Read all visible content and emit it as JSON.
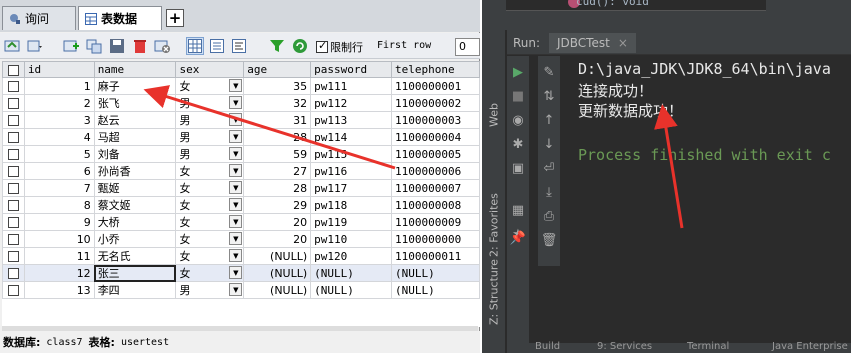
{
  "tabs": {
    "query": "询问",
    "table_data": "表数据",
    "add": "+"
  },
  "toolbar": {
    "limit_rows_label": "限制行",
    "first_row_label": "First row",
    "first_row_value": "0"
  },
  "grid": {
    "columns": [
      "id",
      "name",
      "sex",
      "age",
      "password",
      "telephone"
    ],
    "rows": [
      {
        "id": "1",
        "name": "麻子",
        "sex": "女",
        "age": "35",
        "password": "pw111",
        "telephone": "1100000001"
      },
      {
        "id": "2",
        "name": "张飞",
        "sex": "男",
        "age": "32",
        "password": "pw112",
        "telephone": "1100000002"
      },
      {
        "id": "3",
        "name": "赵云",
        "sex": "男",
        "age": "31",
        "password": "pw113",
        "telephone": "1100000003"
      },
      {
        "id": "4",
        "name": "马超",
        "sex": "男",
        "age": "28",
        "password": "pw114",
        "telephone": "1100000004"
      },
      {
        "id": "5",
        "name": "刘备",
        "sex": "男",
        "age": "59",
        "password": "pw115",
        "telephone": "1100000005"
      },
      {
        "id": "6",
        "name": "孙尚香",
        "sex": "女",
        "age": "27",
        "password": "pw116",
        "telephone": "1100000006"
      },
      {
        "id": "7",
        "name": "甄姬",
        "sex": "女",
        "age": "28",
        "password": "pw117",
        "telephone": "1100000007"
      },
      {
        "id": "8",
        "name": "蔡文姬",
        "sex": "女",
        "age": "29",
        "password": "pw118",
        "telephone": "1100000008"
      },
      {
        "id": "9",
        "name": "大桥",
        "sex": "女",
        "age": "20",
        "password": "pw119",
        "telephone": "1100000009"
      },
      {
        "id": "10",
        "name": "小乔",
        "sex": "女",
        "age": "20",
        "password": "pw110",
        "telephone": "1100000000"
      },
      {
        "id": "11",
        "name": "无名氏",
        "sex": "女",
        "age": "(NULL)",
        "password": "pw120",
        "telephone": "1100000011"
      },
      {
        "id": "12",
        "name": "张三",
        "sex": "女",
        "age": "(NULL)",
        "password": "(NULL)",
        "telephone": "(NULL)"
      },
      {
        "id": "13",
        "name": "李四",
        "sex": "男",
        "age": "(NULL)",
        "password": "(NULL)",
        "telephone": "(NULL)"
      }
    ]
  },
  "status": {
    "db_label": "数据库:",
    "db_value": "class7",
    "table_label": "表格:",
    "table_value": "usertest"
  },
  "ide": {
    "editor_peek": "cud(): void",
    "run_label": "Run:",
    "run_tab": "JDBCTest",
    "side_tabs": [
      "Web",
      "2: Favorites",
      "Z: Structure"
    ],
    "console_lines": [
      {
        "text": "D:\\java_JDK\\JDK8_64\\bin\\java",
        "color": "#e8e8e8"
      },
      {
        "text": "连接成功！",
        "color": "#e8e8e8"
      },
      {
        "text": "更新数据成功！",
        "color": "#e8e8e8"
      },
      {
        "text": "Process finished with exit c",
        "color": "#6a9955"
      }
    ],
    "bottom_tabs": [
      "Build",
      "9: Services",
      "Terminal",
      "Java Enterprise"
    ]
  },
  "colors": {
    "arrow": "#e8322b",
    "console_green": "#6a9955",
    "ide_bg": "#2b2b2b"
  }
}
